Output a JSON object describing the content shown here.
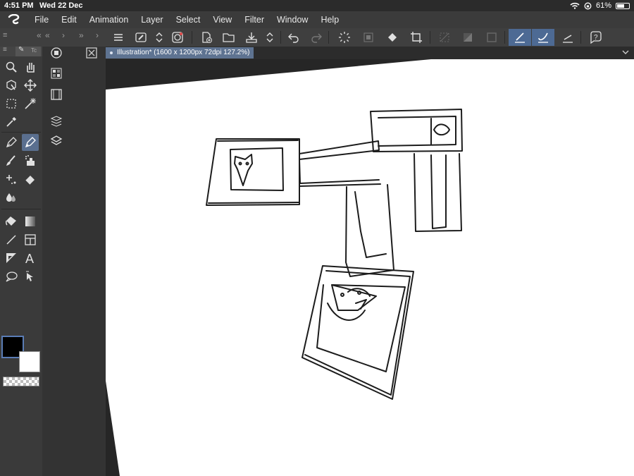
{
  "status_bar": {
    "time": "4:51 PM",
    "date": "Wed 22 Dec",
    "battery": "61%"
  },
  "menu": [
    "File",
    "Edit",
    "Animation",
    "Layer",
    "Select",
    "View",
    "Filter",
    "Window",
    "Help"
  ],
  "document_tab": {
    "label": "Illustration* (1600 x 1200px 72dpi 127.2%)"
  },
  "tool_panel_tab": "Tc",
  "colors": {
    "main": "#000000",
    "sub": "#ffffff",
    "accent": "#5a7cb5",
    "ui_bg": "#3a3a3a"
  },
  "toolbar_icons": [
    "menu-icon",
    "brush-size-icon",
    "updown-icon",
    "quick-access-icon",
    "new-canvas-icon",
    "open-folder-icon",
    "save-icon",
    "updown-icon",
    "undo-icon",
    "redo-icon",
    "loading-icon",
    "clear-icon",
    "fill-icon",
    "crop-icon",
    "select-none-icon",
    "invert-icon",
    "select-border-icon",
    "stroke-brush-icon",
    "stroke-curve-icon",
    "ruler-icon",
    "help-icon"
  ],
  "tools": [
    "zoom",
    "hand",
    "operation",
    "move",
    "selection",
    "auto-select",
    "eyedropper",
    "pen",
    "pencil",
    "brush",
    "airbrush",
    "decoration",
    "eraser",
    "blend",
    "fill",
    "gradient",
    "figure",
    "frame",
    "ruler",
    "text",
    "balloon",
    "correct-line"
  ]
}
